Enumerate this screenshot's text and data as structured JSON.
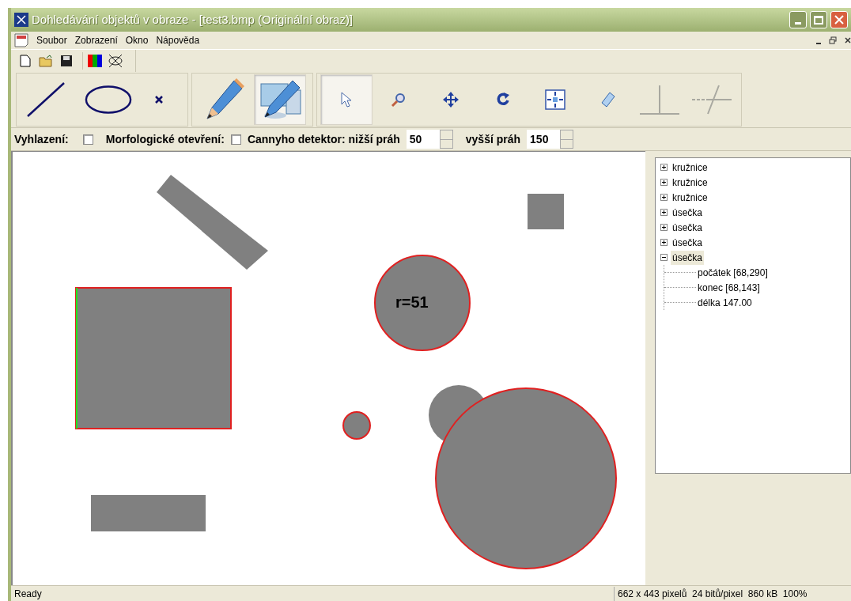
{
  "window": {
    "title": "Dohledávání objektů v obraze - [test3.bmp (Originální obraz)]"
  },
  "menu": [
    "Soubor",
    "Zobrazení",
    "Okno",
    "Nápověda"
  ],
  "toolbar": [
    {
      "kind": "new"
    },
    {
      "kind": "open"
    },
    {
      "kind": "save"
    },
    {
      "kind": "rgb"
    },
    {
      "kind": "nocolor"
    }
  ],
  "draw_tools": [
    {
      "kind": "line",
      "selected": false
    },
    {
      "kind": "ellipse",
      "selected": false
    },
    {
      "kind": "cross",
      "selected": false
    }
  ],
  "mode_tools": [
    {
      "kind": "pencil",
      "selected": false
    },
    {
      "kind": "pencil-monitor",
      "selected": true
    }
  ],
  "edit_tools": [
    {
      "kind": "pointer",
      "selected": true
    },
    {
      "kind": "zoom",
      "selected": false
    },
    {
      "kind": "move",
      "selected": false
    },
    {
      "kind": "rotate",
      "selected": false
    },
    {
      "kind": "fit",
      "selected": false
    },
    {
      "kind": "eraser",
      "selected": false
    },
    {
      "kind": "perpendicular",
      "selected": false
    },
    {
      "kind": "intersect",
      "selected": false
    }
  ],
  "options": {
    "smoothing": {
      "label": "Vyhlazení:",
      "checked": false
    },
    "opening": {
      "label": "Morfologické otevření:",
      "checked": false
    },
    "canny_label": "Cannyho detektor: nižší práh",
    "low": "50",
    "high_label": "vyšší práh",
    "high": "150"
  },
  "canvas": {
    "label": "r=51"
  },
  "tree": [
    {
      "label": "kružnice",
      "expanded": false,
      "selected": false
    },
    {
      "label": "kružnice",
      "expanded": false,
      "selected": false
    },
    {
      "label": "kružnice",
      "expanded": false,
      "selected": false
    },
    {
      "label": "úsečka",
      "expanded": false,
      "selected": false
    },
    {
      "label": "úsečka",
      "expanded": false,
      "selected": false
    },
    {
      "label": "úsečka",
      "expanded": false,
      "selected": false
    },
    {
      "label": "úsečka",
      "expanded": true,
      "selected": true,
      "children": [
        {
          "label": "počátek [68,290]"
        },
        {
          "label": "konec [68,143]"
        },
        {
          "label": "délka 147.00"
        }
      ]
    }
  ],
  "status_bar": {
    "message": "Ready",
    "info": "662 x 443 pixelů  24 bitů/pixel  860 kB  100%"
  }
}
